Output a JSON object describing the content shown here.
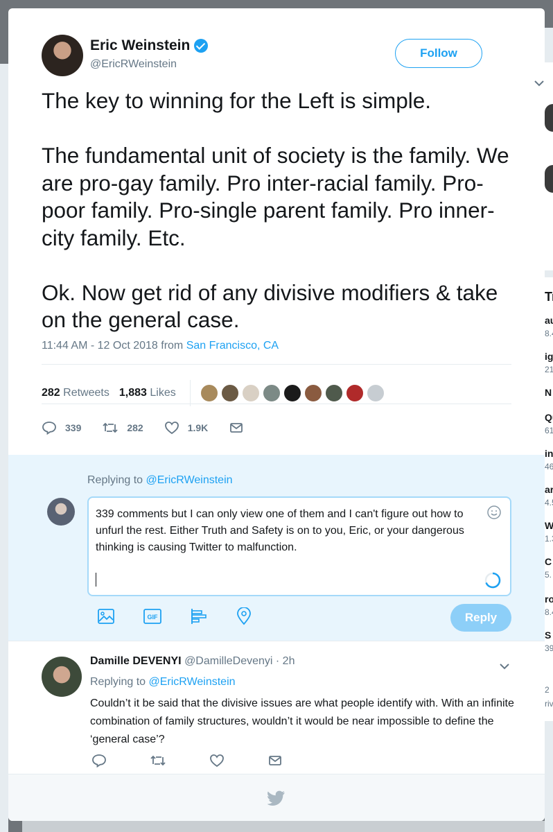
{
  "tweet": {
    "author_name": "Eric Weinstein",
    "author_handle": "@EricRWeinstein",
    "follow_label": "Follow",
    "text": "The key to winning for the Left is simple.\n\nThe fundamental unit of society is the family. We are pro-gay family. Pro inter-racial family. Pro-poor family. Pro-single parent family. Pro inner-city family. Etc.\n\nOk. Now get rid of any divisive modifiers & take on the general case.",
    "timestamp": "11:44 AM - 12 Oct 2018 from",
    "location": "San Francisco, CA",
    "retweets_count": "282",
    "retweets_label": "Retweets",
    "likes_count": "1,883",
    "likes_label": "Likes",
    "actions": {
      "replies": "339",
      "retweets": "282",
      "likes": "1.9K"
    }
  },
  "composer": {
    "replying_prefix": "Replying to",
    "replying_handle": "@EricRWeinstein",
    "draft_text": "339 comments but I can only view one of them and I can't figure out how to unfurl the rest. Either Truth and Safety is on to you, Eric, or your dangerous thinking is causing Twitter to malfunction.",
    "gif_label": "GIF",
    "reply_label": "Reply"
  },
  "reply": {
    "name": "Damille DEVENYI",
    "handle": "@DamilleDevenyi",
    "time": "· 2h",
    "replying_prefix": "Replying to",
    "replying_handle": "@EricRWeinstein",
    "text": "Couldn’t it be said that the divisive issues are what people identify with. With an infinite combination of family structures, wouldn’t it would be near impossible to define the ‘general case’?"
  },
  "background_sidebar": {
    "letters": [
      "Tr",
      "au",
      "8.4",
      "ig",
      "21",
      "N",
      "Qu",
      "61",
      "in",
      "46",
      "ar",
      "4.5",
      "W",
      "1.3",
      "C",
      "5.",
      "ro",
      "8.4",
      "S",
      "39",
      "2",
      "riv"
    ]
  },
  "colors": {
    "accent": "#1da1f2",
    "text": "#14171a",
    "muted": "#657786",
    "composer_bg": "#e8f5fd"
  }
}
